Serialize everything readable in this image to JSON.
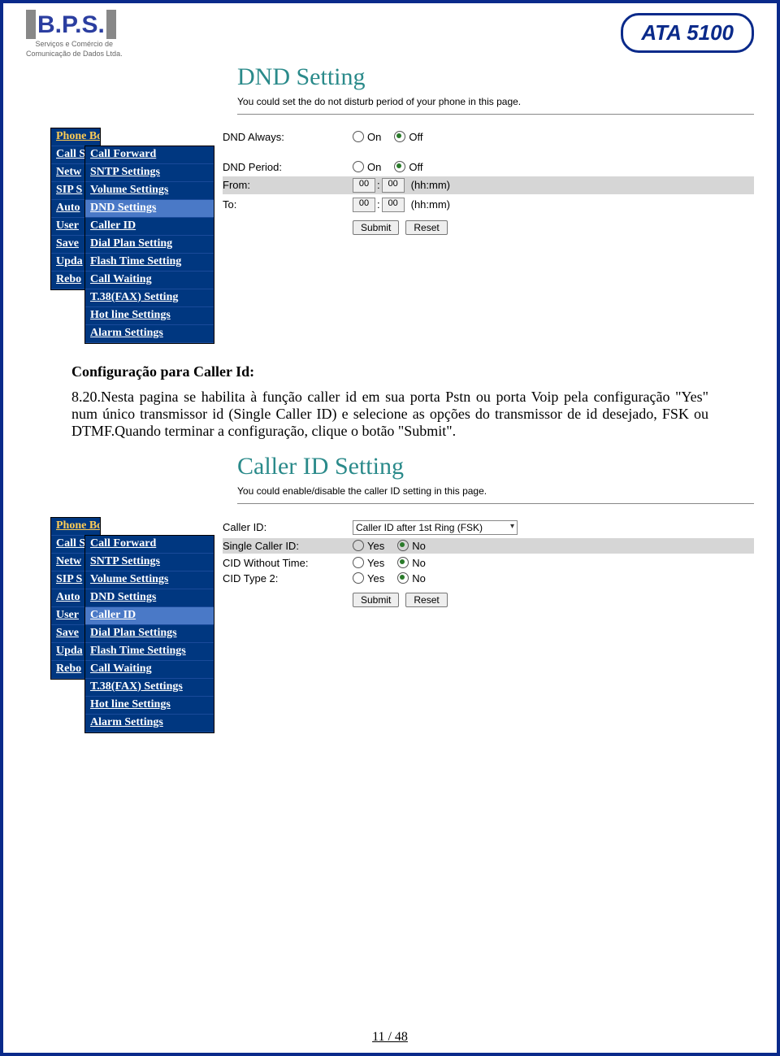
{
  "header": {
    "brand": "B.P.S.",
    "brand_sub1": "Serviços e Comércio de",
    "brand_sub2": "Comunicação de Dados Ltda.",
    "model": "ATA 5100"
  },
  "screenshot1": {
    "title": "DND Setting",
    "desc": "You could set the do not disturb period of your phone in this page.",
    "back_menu": [
      "Phone Book",
      "Call S",
      "Netw",
      "SIP S",
      "Auto",
      "User",
      "Save",
      "Upda",
      "Rebo"
    ],
    "front_menu": [
      "Call Forward",
      "SNTP Settings",
      "Volume Settings",
      "DND Settings",
      "Caller ID",
      "Dial Plan Setting",
      "Flash Time Setting",
      "Call Waiting",
      "T.38(FAX) Setting",
      "Hot line Settings",
      "Alarm Settings"
    ],
    "front_selected_index": 3,
    "rows": {
      "dnd_always": {
        "label": "DND Always:",
        "opt_on": "On",
        "opt_off": "Off",
        "selected": "off"
      },
      "dnd_period": {
        "label": "DND Period:",
        "opt_on": "On",
        "opt_off": "Off",
        "selected": "off"
      },
      "from": {
        "label": "From:",
        "hh": "00",
        "mm": "00",
        "hint": "(hh:mm)"
      },
      "to": {
        "label": "To:",
        "hh": "00",
        "mm": "00",
        "hint": "(hh:mm)"
      }
    },
    "submit": "Submit",
    "reset": "Reset"
  },
  "body_text": {
    "heading1": "Configuração para Caller Id:",
    "para1": "8.20.Nesta pagina se habilita à função caller id em sua porta Pstn ou porta Voip pela configuração \"Yes\" num único transmissor id (Single Caller ID) e selecione as opções do transmissor de id desejado, FSK ou DTMF.Quando terminar a configuração, clique o botão \"Submit\"."
  },
  "screenshot2": {
    "title": "Caller ID Setting",
    "desc": "You could enable/disable the caller ID setting in this page.",
    "back_menu": [
      "Phone Book",
      "Call S",
      "Netw",
      "SIP S",
      "Auto",
      "User",
      "Save",
      "Upda",
      "Rebo"
    ],
    "front_menu": [
      "Call Forward",
      "SNTP Settings",
      "Volume Settings",
      "DND Settings",
      "Caller ID",
      "Dial Plan Settings",
      "Flash Time Settings",
      "Call Waiting",
      "T.38(FAX) Settings",
      "Hot line Settings",
      "Alarm Settings"
    ],
    "front_selected_index": 4,
    "rows": {
      "caller_id": {
        "label": "Caller ID:",
        "value": "Caller ID after 1st Ring (FSK)"
      },
      "single": {
        "label": "Single Caller ID:",
        "opt_yes": "Yes",
        "opt_no": "No",
        "selected": "no"
      },
      "cid_wo_time": {
        "label": "CID Without Time:",
        "opt_yes": "Yes",
        "opt_no": "No",
        "selected": "no"
      },
      "cid_type2": {
        "label": "CID Type 2:",
        "opt_yes": "Yes",
        "opt_no": "No",
        "selected": "no"
      }
    },
    "submit": "Submit",
    "reset": "Reset"
  },
  "footer": {
    "page": "11 / 48"
  }
}
